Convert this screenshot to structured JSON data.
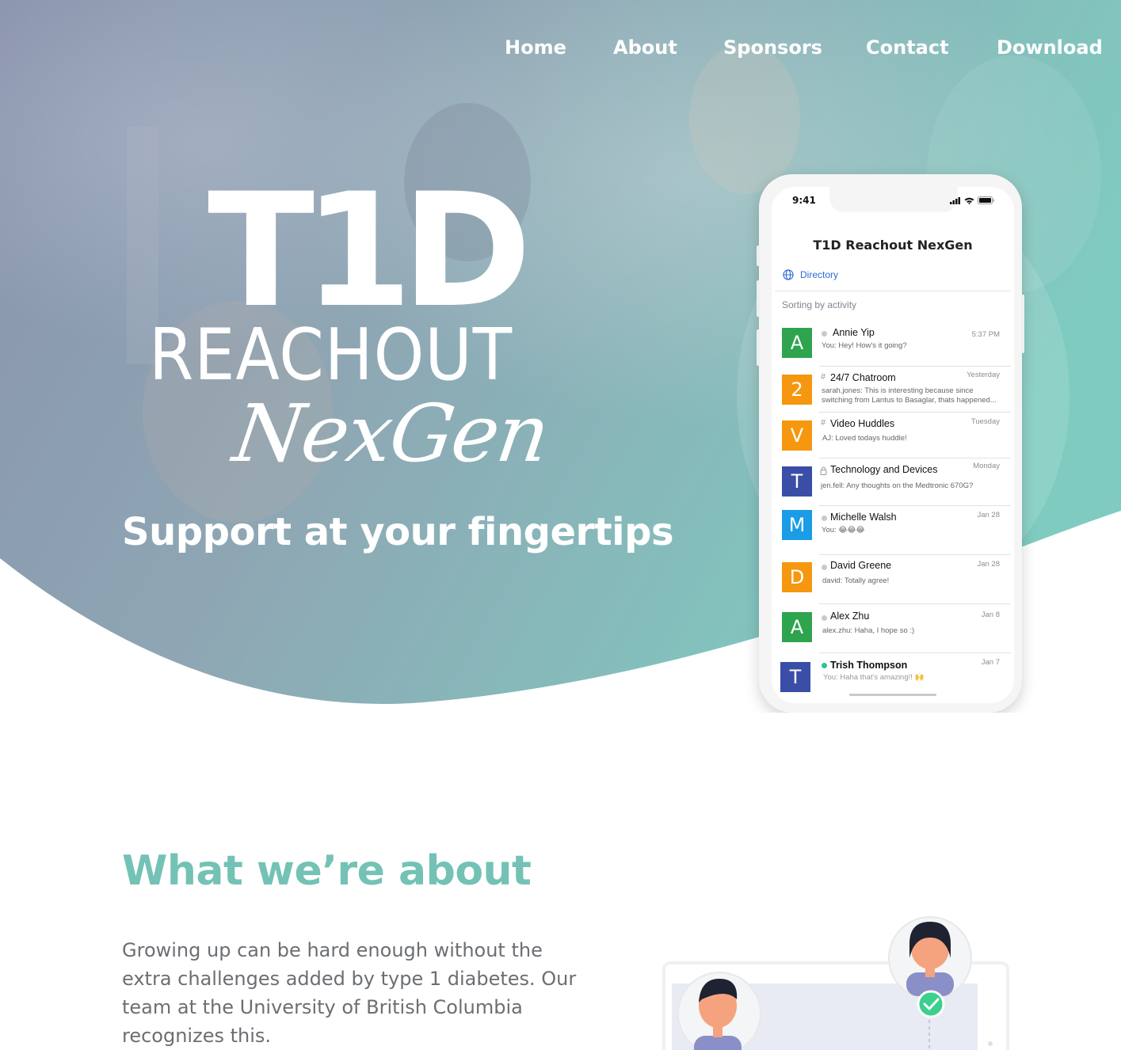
{
  "nav": {
    "items": [
      {
        "label": "Home"
      },
      {
        "label": "About"
      },
      {
        "label": "Sponsors"
      },
      {
        "label": "Contact"
      },
      {
        "label": "Download"
      }
    ]
  },
  "hero": {
    "logo_line1": "T1D",
    "logo_line2": "REACHOUT",
    "logo_line3": "NexGen",
    "tagline": "Support at your fingertips"
  },
  "phone": {
    "status_time": "9:41",
    "app_title": "T1D Reachout NexGen",
    "directory_label": "Directory",
    "sort_label": "Sorting by activity",
    "chats": [
      {
        "avatar": "A",
        "avatar_color": "#2ea44f",
        "prefix": "dot",
        "name": "Annie  Yip",
        "time": "5:37 PM",
        "msg": [
          "You: Hey! How's it going?"
        ]
      },
      {
        "avatar": "2",
        "avatar_color": "#f5970f",
        "prefix": "#",
        "name": "24/7 Chatroom",
        "time": "Yesterday",
        "msg": [
          "sarah.jones: This is interesting because since",
          "switching from Lantus to Basaglar, thats happened..."
        ]
      },
      {
        "avatar": "V",
        "avatar_color": "#f5970f",
        "prefix": "#",
        "name": "Video Huddles",
        "time": "Tuesday",
        "msg": [
          "AJ: Loved todays huddle!"
        ]
      },
      {
        "avatar": "T",
        "avatar_color": "#3a4ea8",
        "prefix": "lock",
        "name": "Technology and Devices",
        "time": "Monday",
        "msg": [
          "jen.fell: Any thoughts on the Medtronic 670G?"
        ]
      },
      {
        "avatar": "M",
        "avatar_color": "#1a9ce6",
        "prefix": "dot",
        "name": "Michelle Walsh",
        "time": "Jan 28",
        "msg": [
          "You: 😂😂😂"
        ]
      },
      {
        "avatar": "D",
        "avatar_color": "#f5970f",
        "prefix": "dot",
        "name": "David Greene",
        "time": "Jan 28",
        "msg": [
          "david: Totally agree!"
        ]
      },
      {
        "avatar": "A",
        "avatar_color": "#2ea44f",
        "prefix": "dot",
        "name": "Alex Zhu",
        "time": "Jan 8",
        "msg": [
          "alex.zhu: Haha, I hope so :)"
        ]
      },
      {
        "avatar": "T",
        "avatar_color": "#3a4ea8",
        "prefix": "dot-green",
        "name": "Trish Thompson",
        "time": "Jan 7",
        "msg": [
          "You: Haha that's amazing!! 🙌"
        ]
      }
    ]
  },
  "about": {
    "title": "What we’re about",
    "body": "Growing up can be hard enough without the extra challenges added by type 1 diabetes. Our team at the University of British Columbia recognizes this."
  },
  "colors": {
    "accent": "#73c2b5",
    "hero_left": "#7d8fb0",
    "hero_right": "#79c8be",
    "body_text": "#6b6f73"
  }
}
